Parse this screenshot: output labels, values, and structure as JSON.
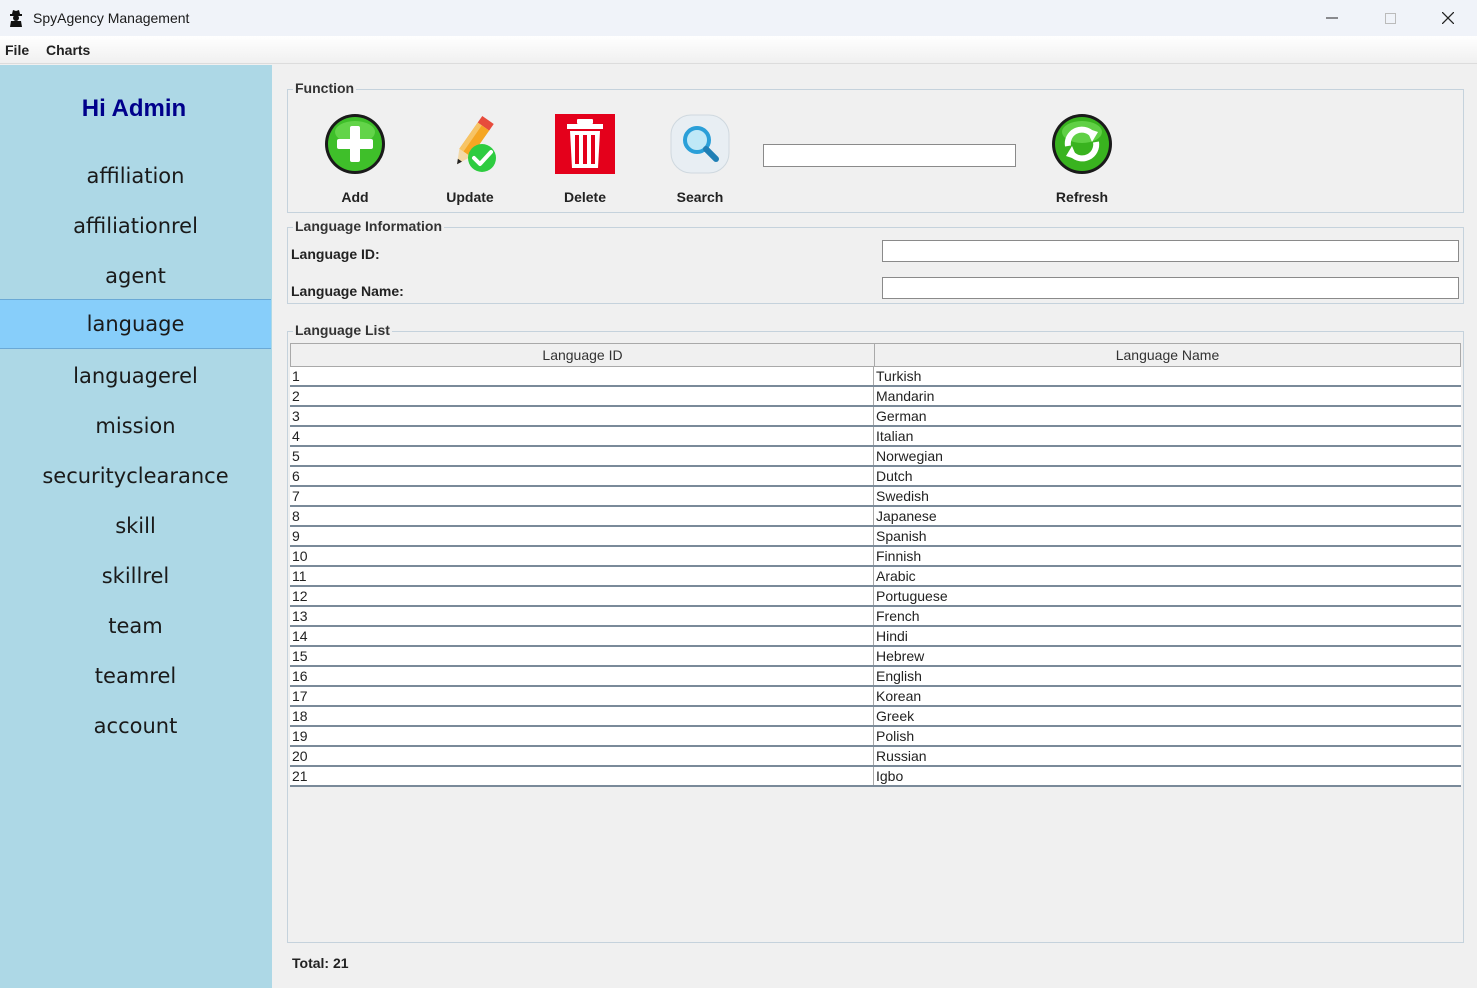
{
  "window": {
    "title": "SpyAgency Management",
    "app_icon": "spy-icon",
    "controls": [
      "minimize-icon",
      "maximize-icon",
      "close-icon"
    ]
  },
  "menu": {
    "file": "File",
    "charts": "Charts"
  },
  "sidebar": {
    "greeting": "Hi Admin",
    "items": [
      {
        "label": "affiliation"
      },
      {
        "label": "affiliationrel"
      },
      {
        "label": "agent"
      },
      {
        "label": "language",
        "active": true
      },
      {
        "label": "languagerel"
      },
      {
        "label": "mission"
      },
      {
        "label": "securityclearance"
      },
      {
        "label": "skill"
      },
      {
        "label": "skillrel"
      },
      {
        "label": "team"
      },
      {
        "label": "teamrel"
      },
      {
        "label": "account"
      }
    ],
    "colors": {
      "background": "#add8e6",
      "active": "#87cefa",
      "greeting": "#00008b"
    }
  },
  "function_panel": {
    "title": "Function",
    "buttons": {
      "add": {
        "label": "Add",
        "icon": "add-icon"
      },
      "update": {
        "label": "Update",
        "icon": "pencil-check-icon"
      },
      "delete": {
        "label": "Delete",
        "icon": "trash-icon"
      },
      "search": {
        "label": "Search",
        "icon": "search-icon"
      },
      "refresh": {
        "label": "Refresh",
        "icon": "refresh-icon"
      }
    },
    "search_value": ""
  },
  "info_panel": {
    "title": "Language Information",
    "id_label": "Language ID:",
    "id_value": "",
    "name_label": "Language Name:",
    "name_value": ""
  },
  "list_panel": {
    "title": "Language List",
    "columns": [
      "Language ID",
      "Language Name"
    ],
    "rows": [
      [
        "1",
        "Turkish"
      ],
      [
        "2",
        "Mandarin"
      ],
      [
        "3",
        "German"
      ],
      [
        "4",
        "Italian"
      ],
      [
        "5",
        "Norwegian"
      ],
      [
        "6",
        "Dutch"
      ],
      [
        "7",
        "Swedish"
      ],
      [
        "8",
        "Japanese"
      ],
      [
        "9",
        "Spanish"
      ],
      [
        "10",
        "Finnish"
      ],
      [
        "11",
        "Arabic"
      ],
      [
        "12",
        "Portuguese"
      ],
      [
        "13",
        "French"
      ],
      [
        "14",
        "Hindi"
      ],
      [
        "15",
        "Hebrew"
      ],
      [
        "16",
        "English"
      ],
      [
        "17",
        "Korean"
      ],
      [
        "18",
        "Greek"
      ],
      [
        "19",
        "Polish"
      ],
      [
        "20",
        "Russian"
      ],
      [
        "21",
        "Igbo"
      ]
    ]
  },
  "footer": {
    "total": "Total: 21"
  }
}
